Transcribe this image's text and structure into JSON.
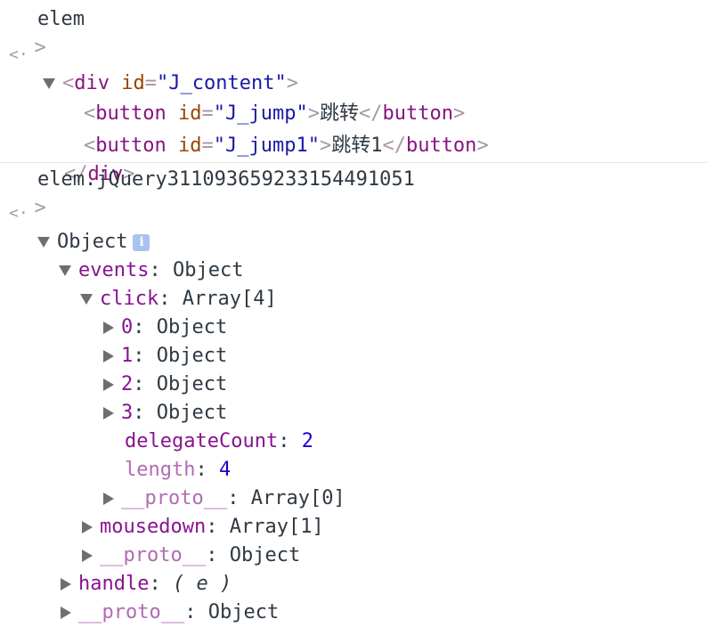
{
  "console": {
    "cmd1": "elem",
    "cmd2": "elem.jQuery311093659233154491051",
    "prompt_glyph": ">",
    "result_glyph": "<·"
  },
  "dom": {
    "div_open_tag": "div",
    "div_attr": "id",
    "div_val": "\"J_content\"",
    "btn1_tag": "button",
    "btn1_attr": "id",
    "btn1_val": "\"J_jump\"",
    "btn1_text": "跳转",
    "btn2_tag": "button",
    "btn2_attr": "id",
    "btn2_val": "\"J_jump1\"",
    "btn2_text": "跳转1",
    "close_btn": "button",
    "close_div": "div"
  },
  "tree": {
    "root_label": "Object",
    "info_glyph": "i",
    "events_key": "events",
    "events_val": "Object",
    "click_key": "click",
    "click_val": "Array[4]",
    "items": [
      {
        "key": "0",
        "val": "Object"
      },
      {
        "key": "1",
        "val": "Object"
      },
      {
        "key": "2",
        "val": "Object"
      },
      {
        "key": "3",
        "val": "Object"
      }
    ],
    "delegate_key": "delegateCount",
    "delegate_val": "2",
    "length_key": "length",
    "length_val": "4",
    "click_proto_key": "__proto__",
    "click_proto_val": "Array[0]",
    "mousedown_key": "mousedown",
    "mousedown_val": "Array[1]",
    "events_proto_key": "__proto__",
    "events_proto_val": "Object",
    "handle_key": "handle",
    "handle_val": "( e )",
    "root_proto_key": "__proto__",
    "root_proto_val": "Object"
  }
}
